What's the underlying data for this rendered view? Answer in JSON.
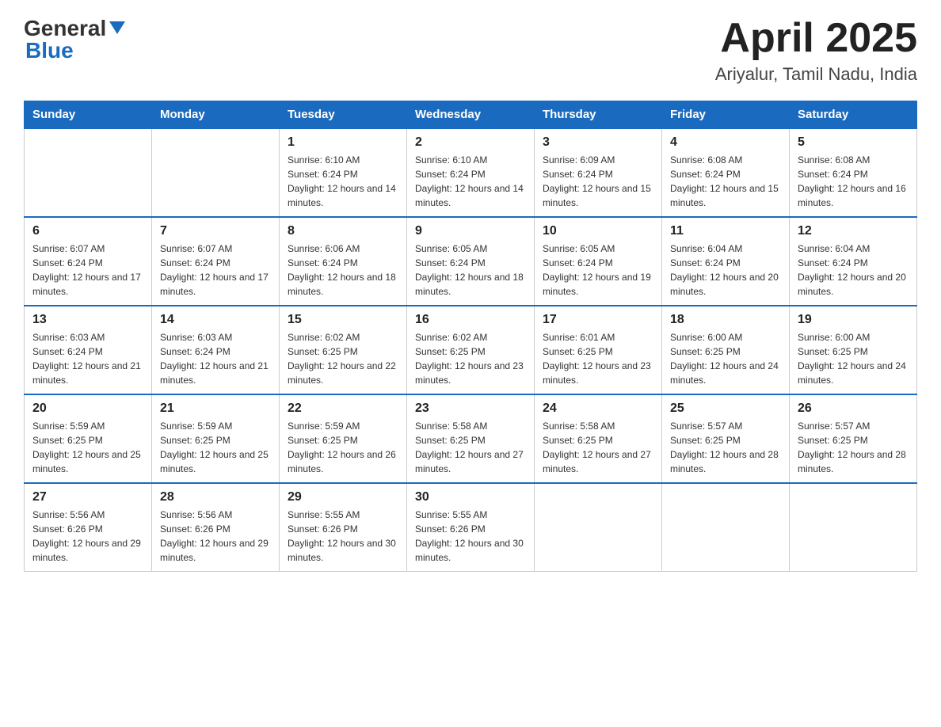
{
  "header": {
    "logo_general": "General",
    "logo_blue": "Blue",
    "month_title": "April 2025",
    "location": "Ariyalur, Tamil Nadu, India"
  },
  "weekdays": [
    "Sunday",
    "Monday",
    "Tuesday",
    "Wednesday",
    "Thursday",
    "Friday",
    "Saturday"
  ],
  "weeks": [
    [
      {
        "day": "",
        "sunrise": "",
        "sunset": "",
        "daylight": ""
      },
      {
        "day": "",
        "sunrise": "",
        "sunset": "",
        "daylight": ""
      },
      {
        "day": "1",
        "sunrise": "Sunrise: 6:10 AM",
        "sunset": "Sunset: 6:24 PM",
        "daylight": "Daylight: 12 hours and 14 minutes."
      },
      {
        "day": "2",
        "sunrise": "Sunrise: 6:10 AM",
        "sunset": "Sunset: 6:24 PM",
        "daylight": "Daylight: 12 hours and 14 minutes."
      },
      {
        "day": "3",
        "sunrise": "Sunrise: 6:09 AM",
        "sunset": "Sunset: 6:24 PM",
        "daylight": "Daylight: 12 hours and 15 minutes."
      },
      {
        "day": "4",
        "sunrise": "Sunrise: 6:08 AM",
        "sunset": "Sunset: 6:24 PM",
        "daylight": "Daylight: 12 hours and 15 minutes."
      },
      {
        "day": "5",
        "sunrise": "Sunrise: 6:08 AM",
        "sunset": "Sunset: 6:24 PM",
        "daylight": "Daylight: 12 hours and 16 minutes."
      }
    ],
    [
      {
        "day": "6",
        "sunrise": "Sunrise: 6:07 AM",
        "sunset": "Sunset: 6:24 PM",
        "daylight": "Daylight: 12 hours and 17 minutes."
      },
      {
        "day": "7",
        "sunrise": "Sunrise: 6:07 AM",
        "sunset": "Sunset: 6:24 PM",
        "daylight": "Daylight: 12 hours and 17 minutes."
      },
      {
        "day": "8",
        "sunrise": "Sunrise: 6:06 AM",
        "sunset": "Sunset: 6:24 PM",
        "daylight": "Daylight: 12 hours and 18 minutes."
      },
      {
        "day": "9",
        "sunrise": "Sunrise: 6:05 AM",
        "sunset": "Sunset: 6:24 PM",
        "daylight": "Daylight: 12 hours and 18 minutes."
      },
      {
        "day": "10",
        "sunrise": "Sunrise: 6:05 AM",
        "sunset": "Sunset: 6:24 PM",
        "daylight": "Daylight: 12 hours and 19 minutes."
      },
      {
        "day": "11",
        "sunrise": "Sunrise: 6:04 AM",
        "sunset": "Sunset: 6:24 PM",
        "daylight": "Daylight: 12 hours and 20 minutes."
      },
      {
        "day": "12",
        "sunrise": "Sunrise: 6:04 AM",
        "sunset": "Sunset: 6:24 PM",
        "daylight": "Daylight: 12 hours and 20 minutes."
      }
    ],
    [
      {
        "day": "13",
        "sunrise": "Sunrise: 6:03 AM",
        "sunset": "Sunset: 6:24 PM",
        "daylight": "Daylight: 12 hours and 21 minutes."
      },
      {
        "day": "14",
        "sunrise": "Sunrise: 6:03 AM",
        "sunset": "Sunset: 6:24 PM",
        "daylight": "Daylight: 12 hours and 21 minutes."
      },
      {
        "day": "15",
        "sunrise": "Sunrise: 6:02 AM",
        "sunset": "Sunset: 6:25 PM",
        "daylight": "Daylight: 12 hours and 22 minutes."
      },
      {
        "day": "16",
        "sunrise": "Sunrise: 6:02 AM",
        "sunset": "Sunset: 6:25 PM",
        "daylight": "Daylight: 12 hours and 23 minutes."
      },
      {
        "day": "17",
        "sunrise": "Sunrise: 6:01 AM",
        "sunset": "Sunset: 6:25 PM",
        "daylight": "Daylight: 12 hours and 23 minutes."
      },
      {
        "day": "18",
        "sunrise": "Sunrise: 6:00 AM",
        "sunset": "Sunset: 6:25 PM",
        "daylight": "Daylight: 12 hours and 24 minutes."
      },
      {
        "day": "19",
        "sunrise": "Sunrise: 6:00 AM",
        "sunset": "Sunset: 6:25 PM",
        "daylight": "Daylight: 12 hours and 24 minutes."
      }
    ],
    [
      {
        "day": "20",
        "sunrise": "Sunrise: 5:59 AM",
        "sunset": "Sunset: 6:25 PM",
        "daylight": "Daylight: 12 hours and 25 minutes."
      },
      {
        "day": "21",
        "sunrise": "Sunrise: 5:59 AM",
        "sunset": "Sunset: 6:25 PM",
        "daylight": "Daylight: 12 hours and 25 minutes."
      },
      {
        "day": "22",
        "sunrise": "Sunrise: 5:59 AM",
        "sunset": "Sunset: 6:25 PM",
        "daylight": "Daylight: 12 hours and 26 minutes."
      },
      {
        "day": "23",
        "sunrise": "Sunrise: 5:58 AM",
        "sunset": "Sunset: 6:25 PM",
        "daylight": "Daylight: 12 hours and 27 minutes."
      },
      {
        "day": "24",
        "sunrise": "Sunrise: 5:58 AM",
        "sunset": "Sunset: 6:25 PM",
        "daylight": "Daylight: 12 hours and 27 minutes."
      },
      {
        "day": "25",
        "sunrise": "Sunrise: 5:57 AM",
        "sunset": "Sunset: 6:25 PM",
        "daylight": "Daylight: 12 hours and 28 minutes."
      },
      {
        "day": "26",
        "sunrise": "Sunrise: 5:57 AM",
        "sunset": "Sunset: 6:25 PM",
        "daylight": "Daylight: 12 hours and 28 minutes."
      }
    ],
    [
      {
        "day": "27",
        "sunrise": "Sunrise: 5:56 AM",
        "sunset": "Sunset: 6:26 PM",
        "daylight": "Daylight: 12 hours and 29 minutes."
      },
      {
        "day": "28",
        "sunrise": "Sunrise: 5:56 AM",
        "sunset": "Sunset: 6:26 PM",
        "daylight": "Daylight: 12 hours and 29 minutes."
      },
      {
        "day": "29",
        "sunrise": "Sunrise: 5:55 AM",
        "sunset": "Sunset: 6:26 PM",
        "daylight": "Daylight: 12 hours and 30 minutes."
      },
      {
        "day": "30",
        "sunrise": "Sunrise: 5:55 AM",
        "sunset": "Sunset: 6:26 PM",
        "daylight": "Daylight: 12 hours and 30 minutes."
      },
      {
        "day": "",
        "sunrise": "",
        "sunset": "",
        "daylight": ""
      },
      {
        "day": "",
        "sunrise": "",
        "sunset": "",
        "daylight": ""
      },
      {
        "day": "",
        "sunrise": "",
        "sunset": "",
        "daylight": ""
      }
    ]
  ]
}
